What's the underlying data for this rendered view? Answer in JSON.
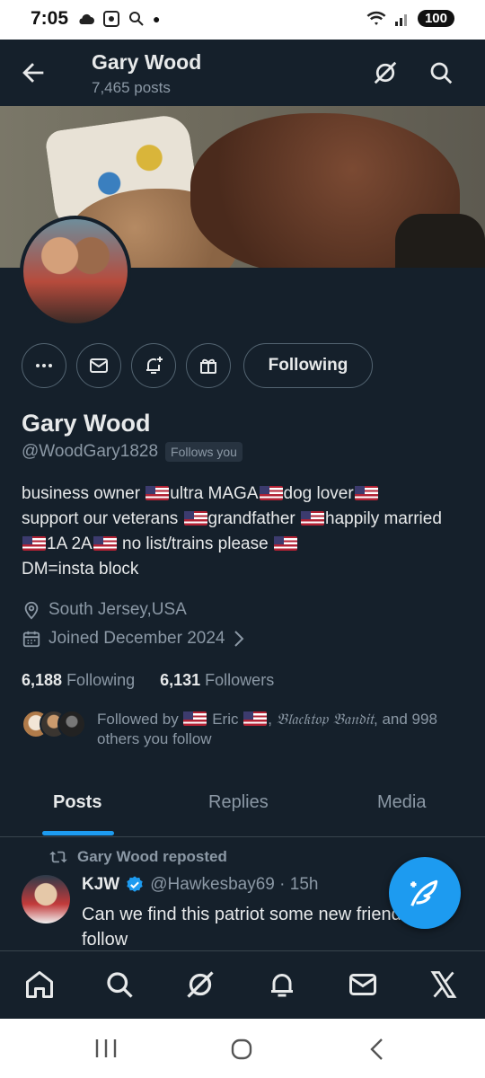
{
  "status_bar": {
    "time": "7:05",
    "battery": "100"
  },
  "header": {
    "title": "Gary Wood",
    "subtitle": "7,465 posts"
  },
  "profile": {
    "name": "Gary Wood",
    "handle": "@WoodGary1828",
    "follows_you_badge": "Follows you",
    "bio_segments": [
      "business owner ",
      "ultra MAGA",
      "dog lover",
      "support our veterans ",
      "grandfather ",
      "happily married ",
      "1A 2A",
      " no list/trains please ",
      "DM=insta block"
    ],
    "location": "South Jersey,USA",
    "joined": "Joined December 2024",
    "following_count": "6,188",
    "following_label": "Following",
    "followers_count": "6,131",
    "followers_label": "Followers",
    "followed_by_prefix": "Followed by",
    "followed_by_name1": "Eric",
    "followed_by_name2": "𝔅𝔩𝔞𝔠𝔨𝔱𝔬𝔭 𝔅𝔞𝔫𝔡𝔦𝔱",
    "followed_by_suffix": ", and 998 others you follow"
  },
  "actions": {
    "following_button": "Following"
  },
  "tabs": [
    {
      "label": "Posts"
    },
    {
      "label": "Replies"
    },
    {
      "label": "Media"
    }
  ],
  "post": {
    "repost_label": "Gary Wood reposted",
    "author_name": "KJW",
    "author_handle_time": "@Hawkesbay69 · 15h",
    "text": "Can we find this patriot some new friends to follow"
  },
  "colors": {
    "background": "#15202b",
    "accent": "#1d9bf0",
    "secondary_text": "#8b98a5",
    "border": "#536471"
  },
  "icons": {
    "back": "arrow-left-icon",
    "grok": "grok-icon",
    "search": "search-icon",
    "more": "more-icon",
    "message": "mail-icon",
    "notify": "bell-add-icon",
    "gift": "gift-icon",
    "location": "location-pin-icon",
    "calendar": "calendar-icon",
    "repost": "repost-icon",
    "verified": "verified-badge-icon",
    "compose": "compose-feather-icon",
    "home": "home-icon",
    "notifications": "bell-icon",
    "x": "x-logo-icon"
  }
}
